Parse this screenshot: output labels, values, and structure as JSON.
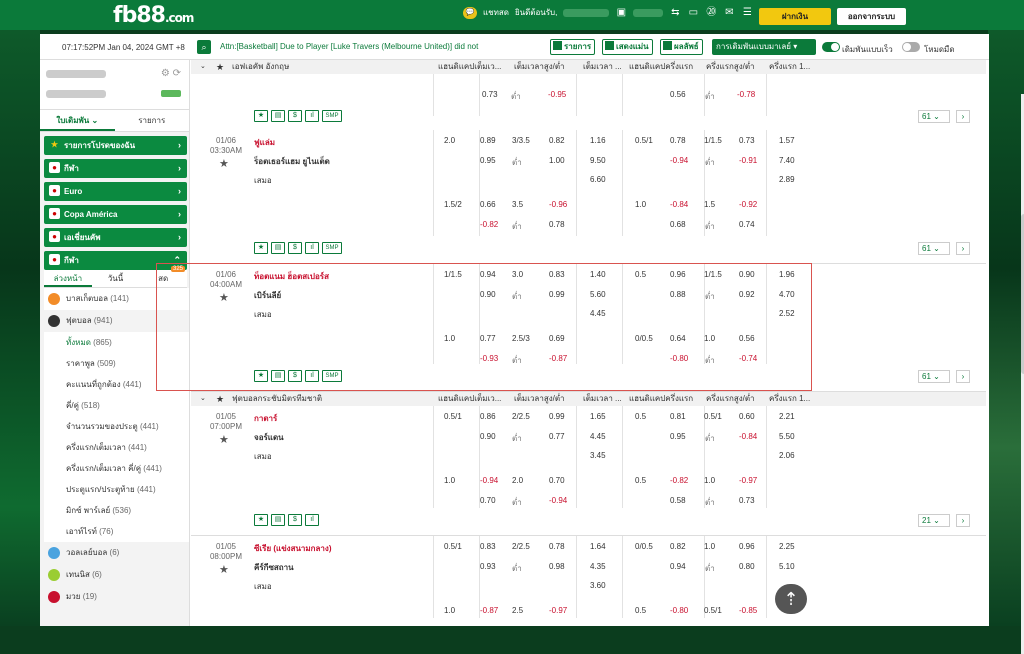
{
  "topbar": {
    "logo": "fb88",
    "logo_suffix": ".com",
    "chat_label": "แชทสด",
    "welcome_label": "ยินดีต้อนรับ,",
    "deposit_label": "ฝากเงิน",
    "logout_label": "ออกจากระบบ"
  },
  "ticker": {
    "clock": "07:17:52PM Jan 04, 2024 GMT +8",
    "news": "Attn:[Basketball] Due to Player [Luke Travers (Melbourne United)] did not",
    "btn_results": "รายการ",
    "btn_live": "เสดงแม่น",
    "btn_score": "ผลลัพธ์",
    "select_bet": "การเดิมพันแบบมาเลย์",
    "toggle_quick": "เดิมพันแบบเร็ว",
    "toggle_dark": "โหมดมืด"
  },
  "sidebar": {
    "tab_bet": "ใบเดิมพัน",
    "tab_list": "รายการ",
    "groups": [
      {
        "label": "รายการโปรดของฉัน",
        "icon": "★"
      },
      {
        "label": "กีฬา",
        "icon": "●"
      },
      {
        "label": "Euro",
        "icon": "●"
      },
      {
        "label": "Copa América",
        "icon": "●"
      },
      {
        "label": "เอเชี่ยนคัพ",
        "icon": "●"
      },
      {
        "label": "กีฬา",
        "icon": "●"
      }
    ],
    "subtabs": [
      "ล่วงหน้า",
      "วันนี้",
      "สด"
    ],
    "live_badge": "325",
    "sports": [
      {
        "name": "บาสเก็ตบอล",
        "count": "(141)",
        "color": "#f28c28"
      },
      {
        "name": "ฟุตบอล",
        "count": "(941)",
        "color": "#333"
      }
    ],
    "leaves": [
      {
        "name": "ทั้งหมด",
        "count": "(865)"
      },
      {
        "name": "ราคาพูล",
        "count": "(509)"
      },
      {
        "name": "คะแนนที่ถูกต้อง",
        "count": "(441)"
      },
      {
        "name": "คี่/คู่",
        "count": "(518)"
      },
      {
        "name": "จำนวนรวมของประตู",
        "count": "(441)"
      },
      {
        "name": "ครึ่งแรก/เต็มเวลา",
        "count": "(441)"
      },
      {
        "name": "ครึ่งแรก/เต็มเวลา คี่/คู่",
        "count": "(441)"
      },
      {
        "name": "ประตูแรก/ประตูท้าย",
        "count": "(441)"
      },
      {
        "name": "มิกซ์ พาร์เลย์",
        "count": "(536)"
      },
      {
        "name": "เอาท์ไรท์",
        "count": "(76)"
      }
    ],
    "sports2": [
      {
        "name": "วอลเลย์บอล",
        "count": "(6)",
        "color": "#4aa3df"
      },
      {
        "name": "เทนนิส",
        "count": "(6)",
        "color": "#9acd32"
      },
      {
        "name": "มวย",
        "count": "(19)",
        "color": "#c8102e"
      }
    ]
  },
  "headers": {
    "league1": "เอฟเอคัพ อังกฤษ",
    "league2": "ฟุตบอลกระชับมิตรทีมชาติ",
    "cols": [
      "แฮนดิแคปเต็มเว...",
      "เต็มเวลาสูง/ต่ำ",
      "เต็มเวลา ...",
      "แฮนดิแคปครึ่งแรก",
      "ครึ่งแรกสูง/ต่ำ",
      "ครึ่งแรก 1..."
    ]
  },
  "match0": {
    "odds": [
      "0.73",
      "ต่ำ",
      "-0.95",
      "0.56",
      "ต่ำ",
      "-0.78"
    ],
    "more": "61"
  },
  "match1": {
    "date": "01/06",
    "time": "03:30AM",
    "home": "ฟูแล่ม",
    "away": "ร็อตเธอร์แฮม ยูไนเต็ด",
    "draw": "เสมอ",
    "r1": [
      "2.0",
      "0.89",
      "3/3.5",
      "0.82",
      "1.16",
      "0.5/1",
      "0.78",
      "1/1.5",
      "0.73",
      "1.57"
    ],
    "r2": [
      "0.95",
      "ต่ำ",
      "1.00",
      "9.50",
      "-0.94",
      "ต่ำ",
      "-0.91",
      "7.40"
    ],
    "r3": [
      "6.60",
      "2.89"
    ],
    "r4": [
      "1.5/2",
      "0.66",
      "3.5",
      "-0.96",
      "1.0",
      "-0.84",
      "1.5",
      "-0.92"
    ],
    "r5": [
      "-0.82",
      "ต่ำ",
      "0.78",
      "0.68",
      "ต่ำ",
      "0.74"
    ],
    "more": "61"
  },
  "match2": {
    "date": "01/06",
    "time": "04:00AM",
    "home": "ท็อตแนม ฮ็อตสเปอร์ส",
    "away": "เบิร์นลีย์",
    "draw": "เสมอ",
    "r1": [
      "1/1.5",
      "0.94",
      "3.0",
      "0.83",
      "1.40",
      "0.5",
      "0.96",
      "1/1.5",
      "0.90",
      "1.96"
    ],
    "r2": [
      "0.90",
      "ต่ำ",
      "0.99",
      "5.60",
      "0.88",
      "ต่ำ",
      "0.92",
      "4.70"
    ],
    "r3": [
      "4.45",
      "2.52"
    ],
    "r4": [
      "1.0",
      "0.77",
      "2.5/3",
      "0.69",
      "0/0.5",
      "0.64",
      "1.0",
      "0.56"
    ],
    "r5": [
      "-0.93",
      "ต่ำ",
      "-0.87",
      "-0.80",
      "ต่ำ",
      "-0.74"
    ],
    "more": "61"
  },
  "match3": {
    "date": "01/05",
    "time": "07:00PM",
    "home": "กาตาร์",
    "away": "จอร์แดน",
    "draw": "เสมอ",
    "r1": [
      "0.5/1",
      "0.86",
      "2/2.5",
      "0.99",
      "1.65",
      "0.5",
      "0.81",
      "0.5/1",
      "0.60",
      "2.21"
    ],
    "r2": [
      "0.90",
      "ต่ำ",
      "0.77",
      "4.45",
      "0.95",
      "ต่ำ",
      "-0.84",
      "5.50"
    ],
    "r3": [
      "3.45",
      "2.06"
    ],
    "r4": [
      "1.0",
      "-0.94",
      "2.0",
      "0.70",
      "0.5",
      "-0.82",
      "1.0",
      "-0.97"
    ],
    "r5": [
      "0.70",
      "ต่ำ",
      "-0.94",
      "0.58",
      "ต่ำ",
      "0.73"
    ],
    "more": "21"
  },
  "match4": {
    "date": "01/05",
    "time": "08:00PM",
    "home": "ซีเรีย (แข่งสนามกลาง)",
    "away": "คีร์กีซสถาน",
    "draw": "เสมอ",
    "r1": [
      "0.5/1",
      "0.83",
      "2/2.5",
      "0.78",
      "1.64",
      "0/0.5",
      "0.82",
      "1.0",
      "0.96",
      "2.25"
    ],
    "r2": [
      "0.93",
      "ต่ำ",
      "0.98",
      "4.35",
      "0.94",
      "ต่ำ",
      "0.80",
      "5.10"
    ],
    "r3": [
      "3.60"
    ],
    "r4": [
      "1.0",
      "-0.87",
      "2.5",
      "-0.97",
      "0.5",
      "-0.80",
      "0.5/1",
      "-0.85"
    ]
  },
  "actions": {
    "smp": "SMP"
  },
  "colors": {
    "brand": "#0b7a3a",
    "accent": "#f2c80f",
    "negative": "#c8102e",
    "highlight": "#d9534f"
  }
}
